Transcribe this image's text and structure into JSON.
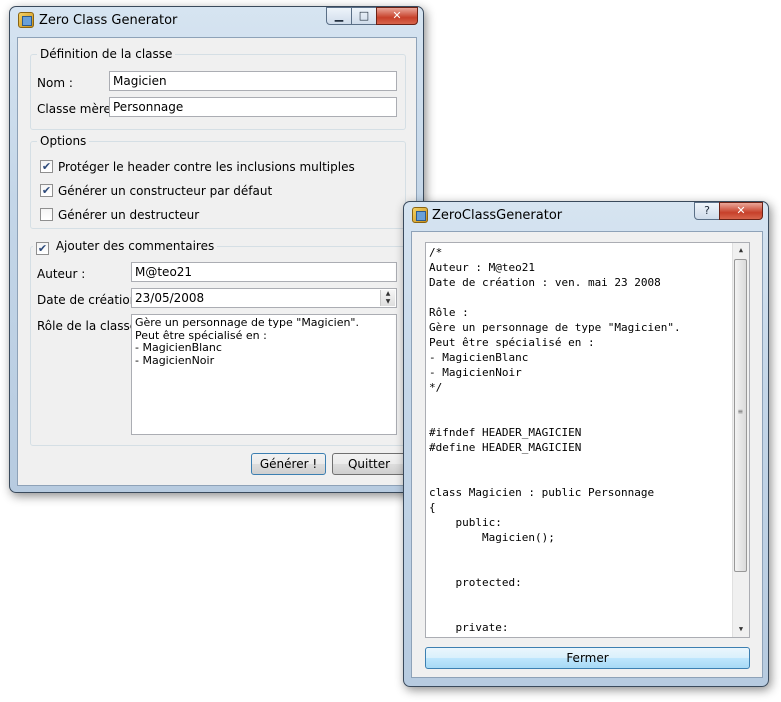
{
  "main_window": {
    "title": "Zero Class Generator",
    "caption": {
      "minimize": "▁",
      "maximize": "□",
      "close": "✕"
    },
    "definition": {
      "group_title": "Définition de la classe",
      "nom_label": "Nom :",
      "nom_value": "Magicien",
      "parent_label": "Classe mère :",
      "parent_value": "Personnage"
    },
    "options": {
      "group_title": "Options",
      "items": [
        {
          "label": "Protéger le header contre les inclusions multiples",
          "checked": true
        },
        {
          "label": "Générer un constructeur par défaut",
          "checked": true
        },
        {
          "label": "Générer un destructeur",
          "checked": false
        }
      ]
    },
    "comments": {
      "toggle_label": "Ajouter des commentaires",
      "toggle_checked": true,
      "author_label": "Auteur :",
      "author_value": "M@teo21",
      "date_label": "Date de création :",
      "date_value": "23/05/2008",
      "role_label": "Rôle de la classe :",
      "role_lines": [
        "Gère un personnage de type \"Magicien\".",
        "Peut être spécialisé en :",
        "- MagicienBlanc",
        "- MagicienNoir"
      ]
    },
    "buttons": {
      "generate": "Générer !",
      "quit": "Quitter"
    }
  },
  "output_window": {
    "title": "ZeroClassGenerator",
    "caption": {
      "help": "?",
      "close": "✕"
    },
    "code_lines": [
      "/*",
      "Auteur : M@teo21",
      "Date de création : ven. mai 23 2008",
      "",
      "Rôle :",
      "Gère un personnage de type \"Magicien\".",
      "Peut être spécialisé en :",
      "- MagicienBlanc",
      "- MagicienNoir",
      "*/",
      "",
      "",
      "#ifndef HEADER_MAGICIEN",
      "#define HEADER_MAGICIEN",
      "",
      "",
      "class Magicien : public Personnage",
      "{",
      "    public:",
      "        Magicien();",
      "",
      "",
      "    protected:",
      "",
      "",
      "    private:"
    ],
    "close_button": "Fermer",
    "scroll": {
      "up": "▲",
      "down": "▼",
      "grip": "≡"
    }
  }
}
